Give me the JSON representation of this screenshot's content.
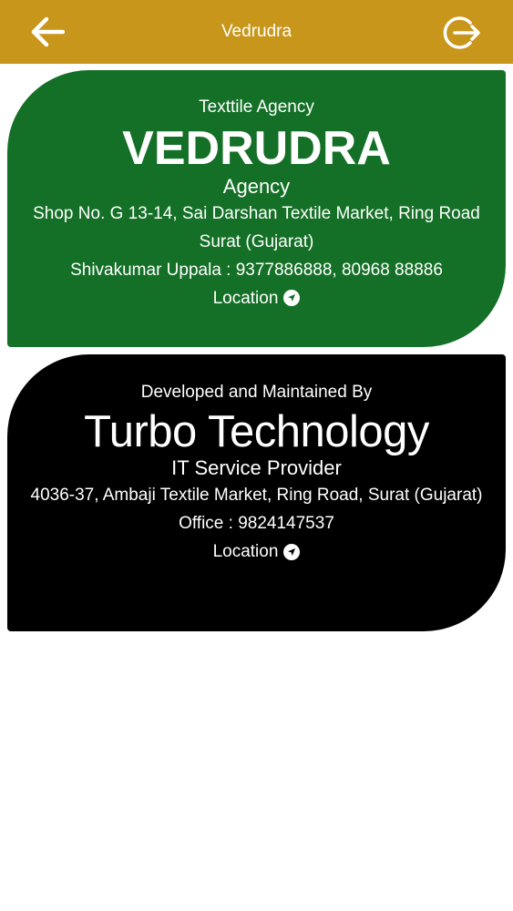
{
  "appbar": {
    "title": "Vedrudra",
    "back_icon": "arrow-left-icon",
    "logout_icon": "logout-icon",
    "bg_color": "#c8961a"
  },
  "agency_card": {
    "overline": "Texttile Agency",
    "name": "VEDRUDRA",
    "subtitle": "Agency",
    "address": "Shop No. G 13-14, Sai Darshan Textile Market, Ring Road Surat (Gujarat)",
    "contact": "Shivakumar Uppala : 9377886888, 80968 88886",
    "location_label": "Location",
    "location_icon": "navigation-circle-icon",
    "bg_color": "#157027"
  },
  "developer_card": {
    "overline": "Developed and Maintained By",
    "name": "Turbo Technology",
    "subtitle": "IT Service Provider",
    "address": "4036-37, Ambaji Textile Market, Ring Road, Surat (Gujarat)",
    "contact": "Office : 9824147537",
    "location_label": "Location",
    "location_icon": "navigation-circle-icon",
    "bg_color": "#000000"
  }
}
